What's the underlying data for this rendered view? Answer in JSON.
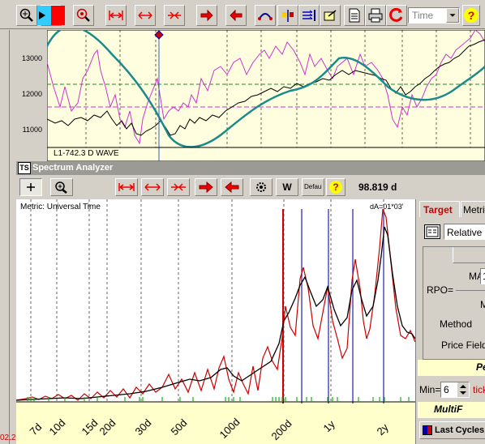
{
  "main_toolbar": {
    "time_select": "Time",
    "help": "?"
  },
  "price_chart": {
    "y_ticks": [
      "13000",
      "12000",
      "11000"
    ],
    "wave_label": "L1-742.3 D WAVE"
  },
  "spectrum": {
    "window_title": "Spectrum Analyzer",
    "title_icon": "TS",
    "default_label": "Default",
    "w_label": "W",
    "help": "?",
    "value": "98.819 d",
    "metric_label": "Metric: Universal Time",
    "da_label": "dA=01*03'",
    "x_ticks": [
      "7d",
      "10d",
      "15d",
      "20d",
      "30d",
      "50d",
      "100d",
      "200d",
      "1y",
      "2y"
    ]
  },
  "right_panel": {
    "tab_target": "Target",
    "tab_metric": "Metric",
    "relative_select": "Relative",
    "ma1_label": "MA1",
    "ma1_value": "1",
    "rpo_label": "RPO=",
    "m_label": "M",
    "method_label": "Method",
    "price_field_label": "Price Field",
    "pe_label": "Pe",
    "min_label": "Min=",
    "min_value": "6",
    "ticks_label": "tick",
    "multif_label": "MultiF",
    "last_cycles": "Last Cycles"
  },
  "left_edge_label": "02.2",
  "colors": {
    "window_bg": "#d4d0c8",
    "chart_bg": "#ffffe0",
    "spectrum_bg": "#ffffff",
    "axis_bg": "#ffffcc",
    "wave_teal": "#1a8a8a",
    "magenta": "#cc33cc",
    "red": "#cc0000",
    "blue_line": "#2222aa",
    "titlebar": "#9c9a94"
  }
}
